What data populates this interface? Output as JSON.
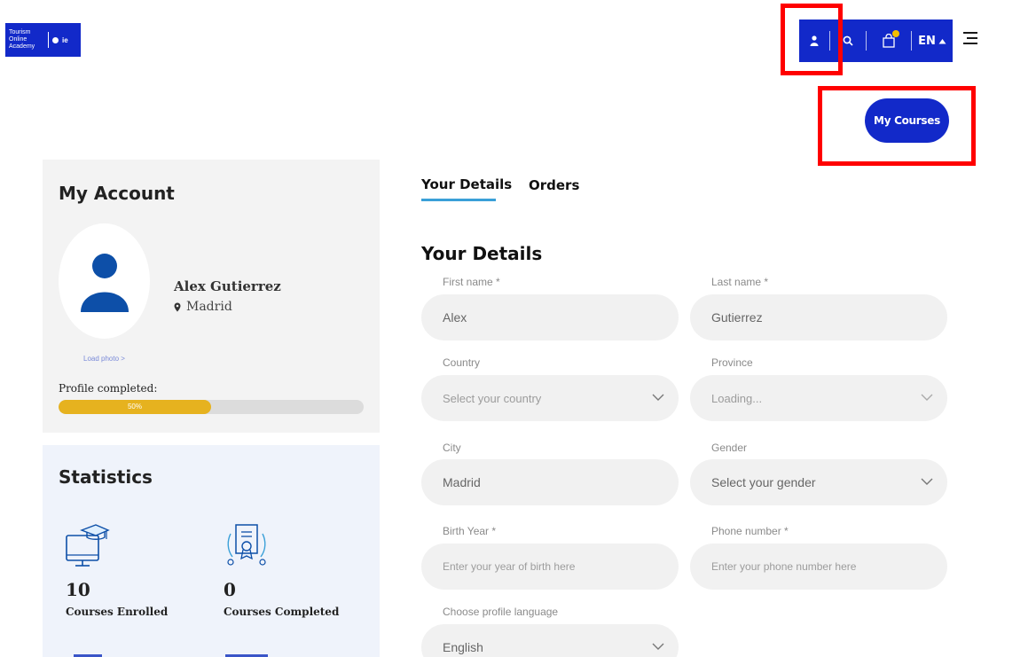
{
  "logo": {
    "line1": "Tourism",
    "line2": "Online",
    "line3": "Academy",
    "mark2": "ie"
  },
  "topbar": {
    "language": "EN"
  },
  "header": {
    "my_courses_label": "My Courses"
  },
  "account": {
    "title": "My Account",
    "user_name": "Alex Gutierrez",
    "user_city": "Madrid",
    "load_photo": "Load photo >",
    "profile_completed_label": "Profile completed:",
    "profile_completed_value": "50%",
    "profile_completed_fraction": 0.5
  },
  "statistics": {
    "title": "Statistics",
    "items": [
      {
        "value": "10",
        "label": "Courses Enrolled",
        "icon": "computer-graduation-icon"
      },
      {
        "value": "0",
        "label": "Courses Completed",
        "icon": "certificate-icon"
      }
    ]
  },
  "tabs": [
    {
      "label": "Your Details",
      "active": true
    },
    {
      "label": "Orders",
      "active": false
    }
  ],
  "form": {
    "heading": "Your Details",
    "first_name": {
      "label": "First name *",
      "value": "Alex"
    },
    "last_name": {
      "label": "Last name *",
      "value": "Gutierrez"
    },
    "country": {
      "label": "Country",
      "placeholder": "Select your country"
    },
    "province": {
      "label": "Province",
      "placeholder": "Loading..."
    },
    "city": {
      "label": "City",
      "value": "Madrid"
    },
    "gender": {
      "label": "Gender",
      "placeholder": "Select your gender"
    },
    "birth_year": {
      "label": "Birth Year *",
      "placeholder": "Enter your year of birth here"
    },
    "phone": {
      "label": "Phone number *",
      "placeholder": "Enter your phone number here"
    },
    "profile_language": {
      "label": "Choose profile language",
      "value": "English"
    }
  },
  "colors": {
    "brand_blue": "#1229c9",
    "highlight_red": "#ff0000",
    "progress_yellow": "#e6b21f",
    "tab_underline": "#3aa0d8"
  }
}
